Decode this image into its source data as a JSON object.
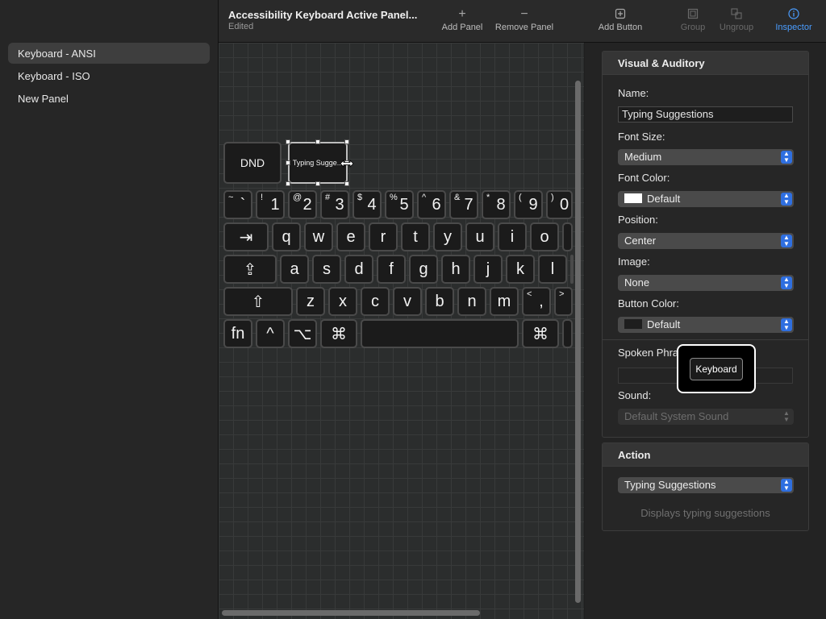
{
  "sidebar": {
    "items": [
      {
        "label": "Keyboard - ANSI",
        "selected": true
      },
      {
        "label": "Keyboard - ISO",
        "selected": false
      },
      {
        "label": "New Panel",
        "selected": false
      }
    ]
  },
  "toolbar": {
    "title": "Accessibility Keyboard Active Panel...",
    "subtitle": "Edited",
    "add_panel": "Add Panel",
    "remove_panel": "Remove Panel",
    "add_button": "Add Button",
    "group": "Group",
    "ungroup": "Ungroup",
    "inspector": "Inspector",
    "icons": {
      "add_panel": "plus-icon",
      "remove_panel": "minus-icon",
      "add_button": "add-button-icon",
      "group": "group-icon",
      "ungroup": "ungroup-icon",
      "inspector": "info-icon"
    },
    "accent": "#4a9dff"
  },
  "canvas": {
    "dnd_label": "DND",
    "typing_label": "Typing Sugge...",
    "rows": [
      [
        {
          "sup": "~",
          "main": "`"
        },
        {
          "sup": "!",
          "main": "1"
        },
        {
          "sup": "@",
          "main": "2"
        },
        {
          "sup": "#",
          "main": "3"
        },
        {
          "sup": "$",
          "main": "4"
        },
        {
          "sup": "%",
          "main": "5"
        },
        {
          "sup": "^",
          "main": "6"
        },
        {
          "sup": "&",
          "main": "7"
        },
        {
          "sup": "*",
          "main": "8"
        },
        {
          "sup": "(",
          "main": "9"
        },
        {
          "sup": ")",
          "main": "0"
        }
      ],
      [
        {
          "main": "⇥"
        },
        {
          "main": "q"
        },
        {
          "main": "w"
        },
        {
          "main": "e"
        },
        {
          "main": "r"
        },
        {
          "main": "t"
        },
        {
          "main": "y"
        },
        {
          "main": "u"
        },
        {
          "main": "i"
        },
        {
          "main": "o"
        },
        {
          "main": ""
        }
      ],
      [
        {
          "main": "⇪"
        },
        {
          "main": "a"
        },
        {
          "main": "s"
        },
        {
          "main": "d"
        },
        {
          "main": "f"
        },
        {
          "main": "g"
        },
        {
          "main": "h"
        },
        {
          "main": "j"
        },
        {
          "main": "k"
        },
        {
          "main": "l"
        },
        {
          "main": ""
        }
      ],
      [
        {
          "main": "⇧"
        },
        {
          "main": "z"
        },
        {
          "main": "x"
        },
        {
          "main": "c"
        },
        {
          "main": "v"
        },
        {
          "main": "b"
        },
        {
          "main": "n"
        },
        {
          "main": "m"
        },
        {
          "sup": "<",
          "main": ","
        },
        {
          "sup": ">",
          "main": ""
        }
      ],
      [
        {
          "main": "fn"
        },
        {
          "main": "^"
        },
        {
          "main": "⌥"
        },
        {
          "main": "⌘"
        },
        {
          "main": ""
        },
        {
          "main": "⌘"
        },
        {
          "main": ""
        }
      ]
    ]
  },
  "inspector": {
    "visual_heading": "Visual & Auditory",
    "name_label": "Name:",
    "name_value": "Typing Suggestions",
    "font_size_label": "Font Size:",
    "font_size_value": "Medium",
    "font_color_label": "Font Color:",
    "font_color_value": "Default",
    "font_color_swatch": "#ffffff",
    "position_label": "Position:",
    "position_value": "Center",
    "image_label": "Image:",
    "image_value": "None",
    "button_color_label": "Button Color:",
    "button_color_value": "Default",
    "button_color_swatch": "#1e1e1e",
    "spoken_label": "Spoken Phra",
    "spoken_value": "",
    "sound_label": "Sound:",
    "sound_value": "Default System Sound",
    "action_heading": "Action",
    "action_value": "Typing Suggestions",
    "action_hint": "Displays typing suggestions",
    "popup_accent": "#2f6fe0"
  },
  "overlay": {
    "keyboard_tip": "Keyboard"
  }
}
